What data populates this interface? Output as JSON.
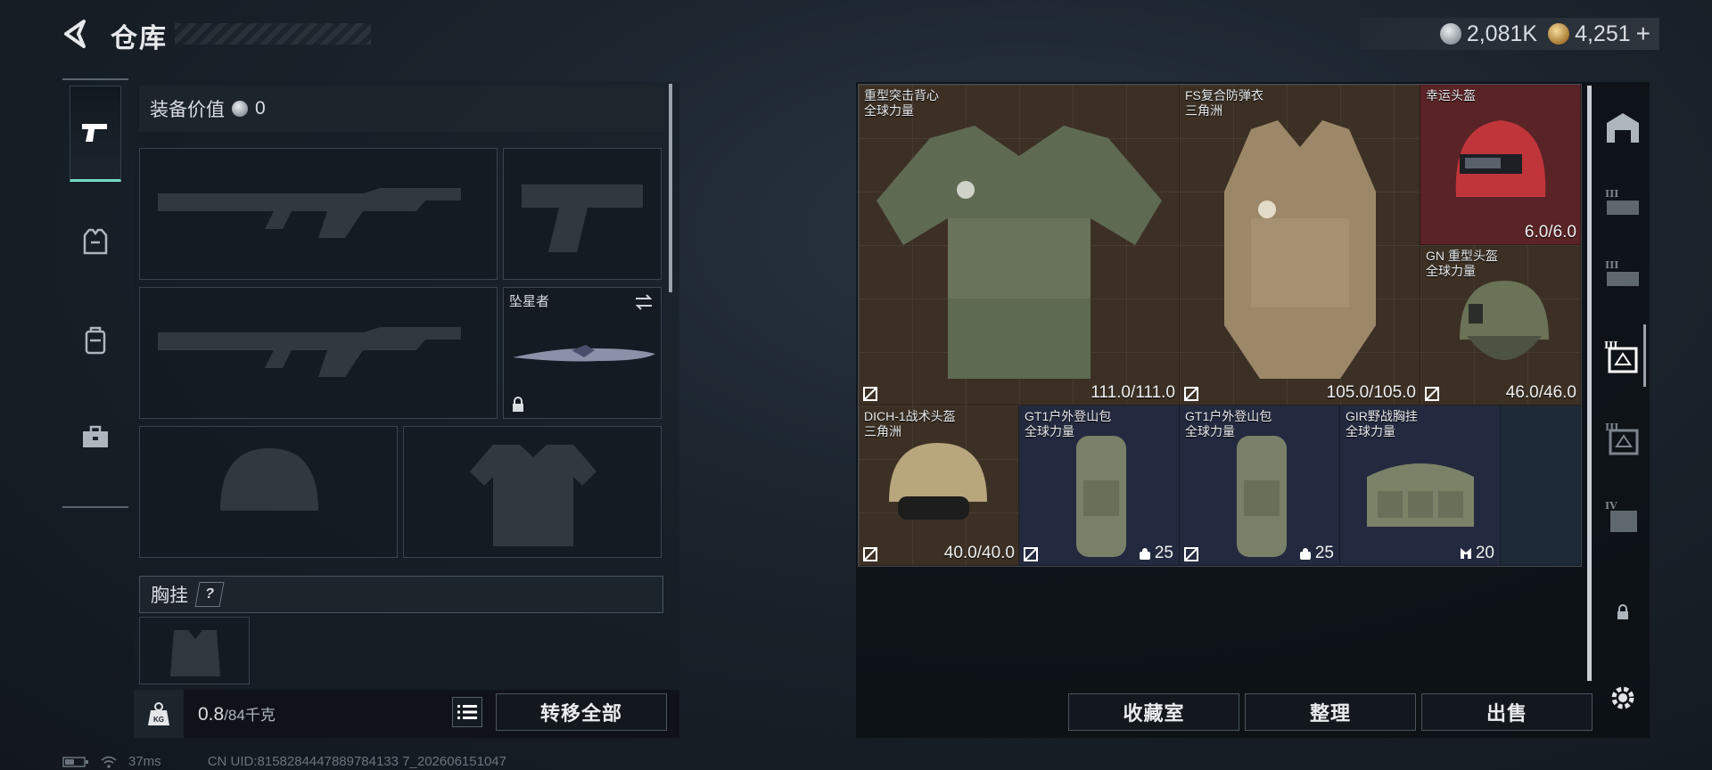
{
  "header": {
    "title": "仓库",
    "currency": [
      {
        "icon": "silver-coin-icon",
        "value": "2,081K",
        "color": "#c9ced2"
      },
      {
        "icon": "gold-coin-icon",
        "value": "4,251",
        "plus": "+",
        "color": "#d9b067"
      }
    ]
  },
  "loadout": {
    "value_label": "装备价值",
    "value": "0",
    "melee_name": "坠星者",
    "vest_label": "胸挂",
    "vest_help": "?",
    "weight_current": "0.8",
    "weight_max": "/84千克",
    "transfer_all": "转移全部"
  },
  "storage": {
    "items": [
      {
        "name": "重型突击背心",
        "sub": "全球力量",
        "durability": "111.0/111.0",
        "bg": "brown"
      },
      {
        "name": "FS复合防弹衣",
        "sub": "三角洲",
        "durability": "105.0/105.0",
        "bg": "brown"
      },
      {
        "name": "幸运头盔",
        "sub": "",
        "durability": "6.0/6.0",
        "bg": "red"
      },
      {
        "name": "GN 重型头盔",
        "sub": "全球力量",
        "durability": "46.0/46.0",
        "bg": "brown"
      },
      {
        "name": "DICH-1战术头盔",
        "sub": "三角洲",
        "durability": "40.0/40.0",
        "bg": "brown"
      },
      {
        "name": "GT1户外登山包",
        "sub": "全球力量",
        "capacity": "25",
        "bg": "navy"
      },
      {
        "name": "GT1户外登山包",
        "sub": "全球力量",
        "capacity": "25",
        "bg": "navy"
      },
      {
        "name": "GIR野战胸挂",
        "sub": "全球力量",
        "capacity": "20",
        "bg": "navy"
      }
    ],
    "buttons": {
      "collection": "收藏室",
      "sort": "整理",
      "sell": "出售"
    }
  },
  "status": {
    "ping": "37ms",
    "uid": "CN UID:8158284447889784133 7_202606151047"
  }
}
